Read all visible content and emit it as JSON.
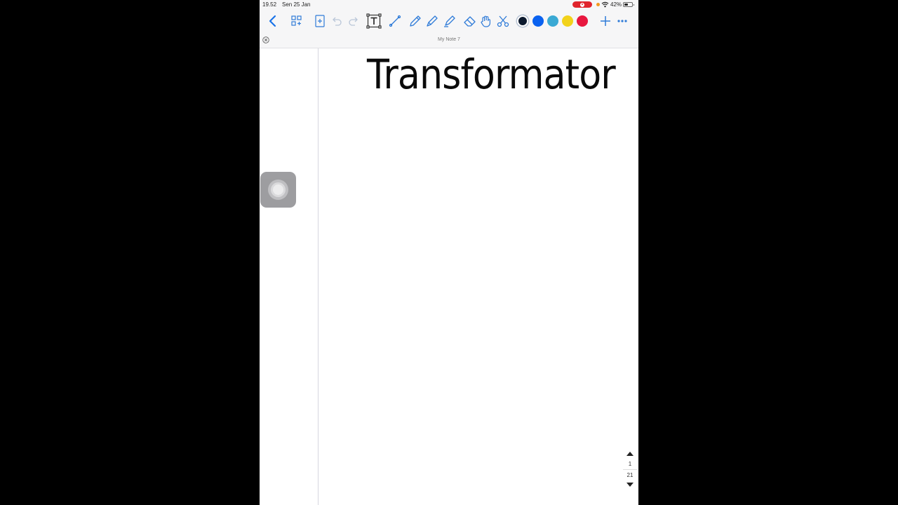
{
  "status_bar": {
    "time": "19.52",
    "date": "Sen 25 Jan",
    "battery": "42%",
    "icons": [
      "screen-recording-icon",
      "orange-indicator-icon",
      "wifi-icon",
      "battery-icon"
    ]
  },
  "toolbar": {
    "tools": [
      "back-chevron-icon",
      "thumbnails-icon",
      "add-page-icon",
      "undo-icon",
      "redo-icon",
      "text-tool-icon",
      "line-tool-icon",
      "pencil-icon",
      "pen-icon",
      "highlighter-icon",
      "eraser-icon",
      "lasso-hand-icon",
      "scissors-icon",
      "add-icon",
      "more-icon"
    ],
    "colors": [
      "#0c1a2e",
      "#0a62f0",
      "#3aa9d4",
      "#f2d21b",
      "#e8173f"
    ]
  },
  "document": {
    "title": "My Note 7",
    "heading": "Transformator"
  },
  "page_nav": {
    "current": "1",
    "total": "21"
  }
}
